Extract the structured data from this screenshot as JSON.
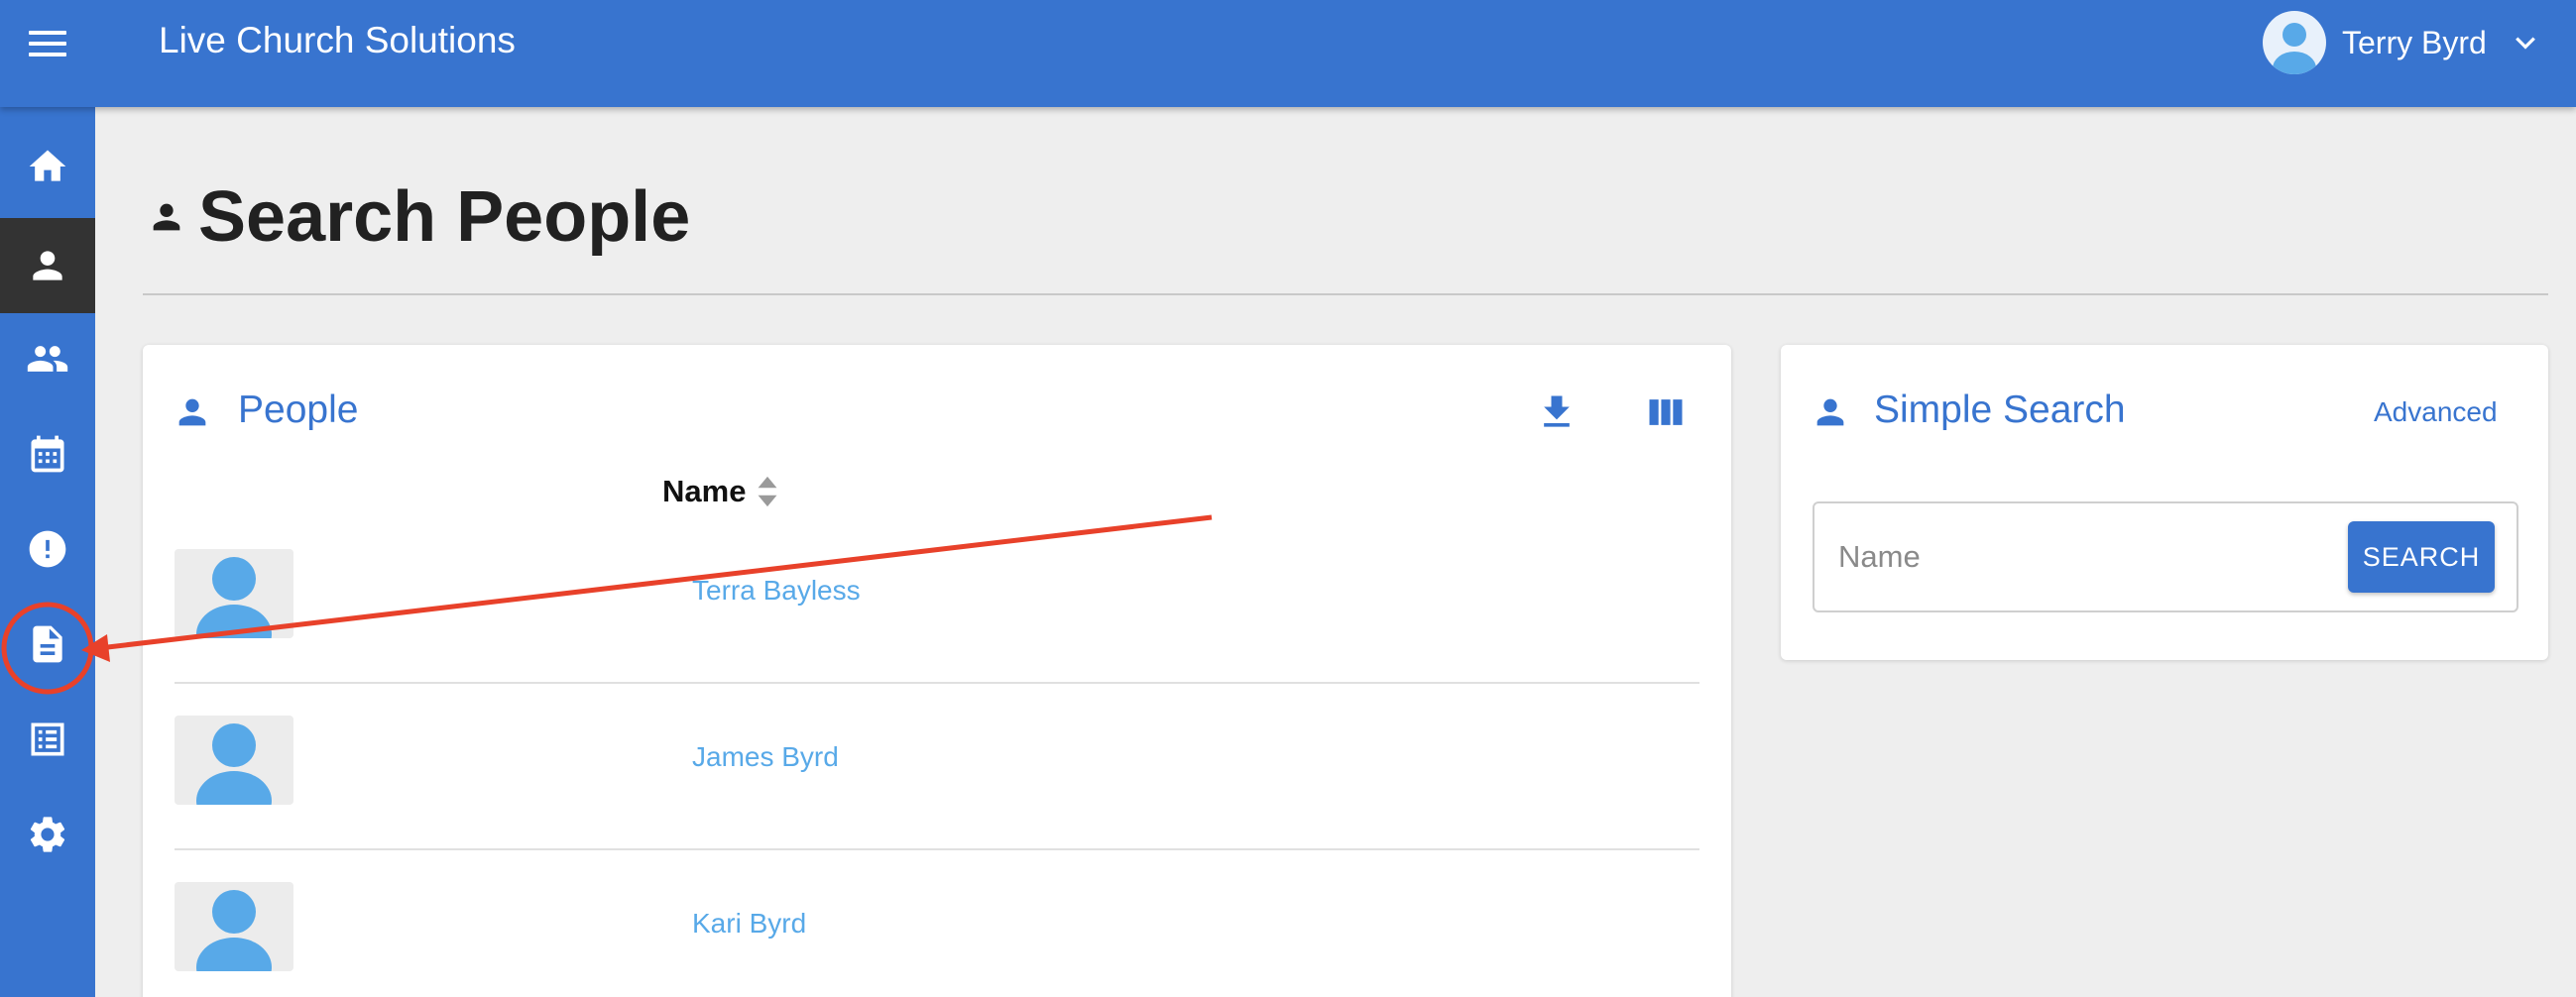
{
  "header": {
    "app_title": "Live Church Solutions",
    "user_name": "Terry Byrd",
    "menu_icon": "hamburger-menu-icon",
    "avatar_icon": "user-avatar-icon",
    "chevron_icon": "chevron-down-icon"
  },
  "sidebar": {
    "items": [
      {
        "icon": "home-icon",
        "active": false
      },
      {
        "icon": "person-icon",
        "active": true
      },
      {
        "icon": "people-icon",
        "active": false
      },
      {
        "icon": "calendar-icon",
        "active": false
      },
      {
        "icon": "alert-icon",
        "active": false
      },
      {
        "icon": "document-icon",
        "active": false,
        "highlighted": true
      },
      {
        "icon": "list-icon",
        "active": false
      },
      {
        "icon": "settings-icon",
        "active": false
      }
    ]
  },
  "page": {
    "title": "Search People",
    "title_icon": "person-icon"
  },
  "people_card": {
    "title": "People",
    "title_icon": "person-icon",
    "download_icon": "download-icon",
    "columns_icon": "columns-icon",
    "name_column": "Name",
    "sort_icon": "sort-icon",
    "people": [
      {
        "name": "Terra Bayless"
      },
      {
        "name": "James Byrd"
      },
      {
        "name": "Kari Byrd"
      }
    ]
  },
  "search_card": {
    "title": "Simple Search",
    "title_icon": "person-icon",
    "advanced_label": "Advanced",
    "input_placeholder": "Name",
    "input_value": "",
    "search_button": "SEARCH"
  },
  "colors": {
    "primary": "#3874cf",
    "sidebar_active": "#333333",
    "link": "#58a9e8",
    "background": "#eeeeee",
    "annotation": "#e8412a"
  }
}
